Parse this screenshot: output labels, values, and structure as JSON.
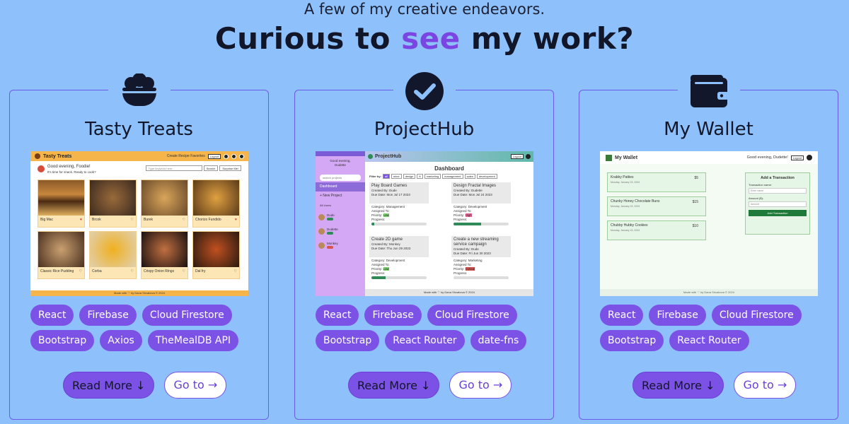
{
  "header": {
    "subtitle": "A few of my creative endeavors.",
    "title_before": "Curious to ",
    "title_accent": "see",
    "title_after": " my work?"
  },
  "colors": {
    "background": "#8ec0fb",
    "accent": "#7b45e3",
    "tag": "#7c52e6",
    "card_border": "#6c5ce7"
  },
  "projects": [
    {
      "icon": "bowl-food-icon",
      "title": "Tasty Treats",
      "tags": [
        "React",
        "Firebase",
        "Cloud Firestore",
        "Bootstrap",
        "Axios",
        "TheMealDB API"
      ],
      "read_more_label": "Read More ↓",
      "go_to_label": "Go to →",
      "preview": {
        "brand": "Tasty Treats",
        "nav": "Create Recipe  Favorites",
        "logout": "Logout",
        "greeting": "Good evening, Foodie!",
        "subgreeting": "It's time for snack. Ready to cook?",
        "search_placeholder": "Type keyword here...",
        "search_button": "Search",
        "random_button": "Surprise Me!",
        "meals": [
          "Big Mac",
          "Brcok",
          "Burek",
          "Chorizo Fundido",
          "Classic Rice Pudding",
          "Corba",
          "Crispy Onion Rings",
          "Dal fry"
        ],
        "footer": "Made with ♡ by Dana Shvabova © 2024"
      }
    },
    {
      "icon": "check-circle-icon",
      "title": "ProjectHub",
      "tags": [
        "React",
        "Firebase",
        "Cloud Firestore",
        "Bootstrap",
        "React Router",
        "date-fns"
      ],
      "read_more_label": "Read More ↓",
      "go_to_label": "Go to →",
      "preview": {
        "brand": "ProjectHub",
        "logout": "Logout",
        "greeting": "Good evening,",
        "username": "Dudette",
        "search_placeholder": "search projects",
        "nav_dashboard": "Dashboard",
        "nav_new": "+ New Project",
        "users_label": "All Users",
        "users": [
          "Dude",
          "Dudette",
          "Monkey"
        ],
        "dashboard_title": "Dashboard",
        "filter_label": "Filter by:",
        "filters": [
          "all",
          "mine",
          "design",
          "ft",
          "marketing",
          "management",
          "sales",
          "development"
        ],
        "cards": [
          {
            "title": "Play Board Games",
            "created": "Created By: Dude",
            "due": "Due Date: Mon Jul 17 2023",
            "category": "Category: Management",
            "assigned": "Assigned To:",
            "priority": "Priority:",
            "priority_value": "Low",
            "progress": "Progress:",
            "progress_value": 0.05
          },
          {
            "title": "Design Fractal Images",
            "created": "Created By: Dudette",
            "due": "Due Date: Mon Jul 24 2023",
            "category": "Category: Development",
            "assigned": "Assigned To:",
            "priority": "Priority:",
            "priority_value": "High",
            "progress": "Progress:",
            "progress_value": 0.5
          },
          {
            "title": "Create 2D game",
            "created": "Created By: Monkey",
            "due": "Due Date: Thu Jun 29 2023",
            "category": "Category: Development",
            "assigned": "Assigned To:",
            "priority": "Priority:",
            "priority_value": "Low",
            "progress": "Progress:",
            "progress_value": 0.25
          },
          {
            "title": "Create a new streaming service campaign",
            "created": "Created By: Dude",
            "due": "Due Date: Fri Jun 30 2023",
            "category": "Category: Marketing",
            "assigned": "Assigned To:",
            "priority": "Priority:",
            "priority_value": "Critical",
            "progress": "Progress:",
            "progress_value": 0.0
          }
        ],
        "footer": "Made with ♡ by Dana Shvabova © 2024"
      }
    },
    {
      "icon": "wallet-icon",
      "title": "My Wallet",
      "tags": [
        "React",
        "Firebase",
        "Cloud Firestore",
        "Bootstrap",
        "React Router"
      ],
      "read_more_label": "Read More ↓",
      "go_to_label": "Go to →",
      "preview": {
        "brand": "My Wallet",
        "greeting": "Good evening, Dudette!",
        "logout": "Logout",
        "transactions": [
          {
            "name": "Krabby Patties",
            "amount": "$5",
            "date": "Monday, January 15, 2024"
          },
          {
            "name": "Chunky Honey Chocolate Buns",
            "amount": "$15",
            "date": "Monday, January 15, 2024"
          },
          {
            "name": "Chubby Hubby Cookies",
            "amount": "$10",
            "date": "Monday, January 15, 2024"
          }
        ],
        "form_title": "Add a Transaction",
        "field_name_label": "Transaction name:",
        "field_name_placeholder": "Enter name",
        "field_amount_label": "Amount ($):",
        "field_amount_placeholder": "Amount",
        "add_button": "Add Transaction",
        "footer": "Made with ♡ by Dana Shvabova © 2024"
      }
    }
  ]
}
